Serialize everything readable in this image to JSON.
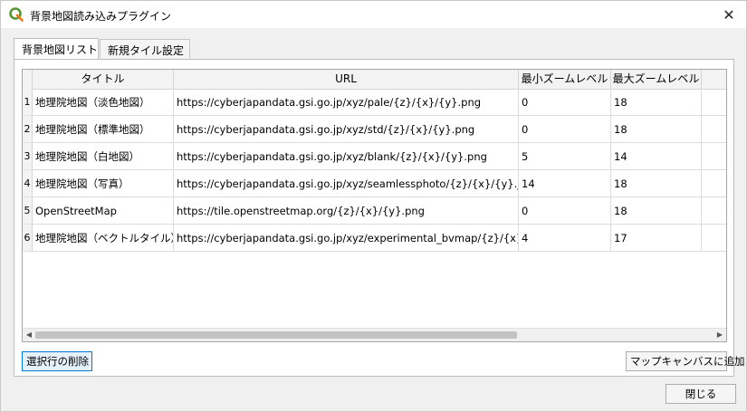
{
  "window": {
    "title": "背景地図読み込みプラグイン",
    "close_glyph": "✕"
  },
  "tabs": [
    {
      "label": "背景地図リスト",
      "active": true
    },
    {
      "label": "新規タイル設定",
      "active": false
    }
  ],
  "table": {
    "columns": [
      "タイトル",
      "URL",
      "最小ズームレベル",
      "最大ズームレベル"
    ],
    "rows": [
      {
        "num": "1",
        "title": "地理院地図（淡色地図）",
        "url": "https://cyberjapandata.gsi.go.jp/xyz/pale/{z}/{x}/{y}.png",
        "min": "0",
        "max": "18"
      },
      {
        "num": "2",
        "title": "地理院地図（標準地図）",
        "url": "https://cyberjapandata.gsi.go.jp/xyz/std/{z}/{x}/{y}.png",
        "min": "0",
        "max": "18"
      },
      {
        "num": "3",
        "title": "地理院地図（白地図）",
        "url": "https://cyberjapandata.gsi.go.jp/xyz/blank/{z}/{x}/{y}.png",
        "min": "5",
        "max": "14"
      },
      {
        "num": "4",
        "title": "地理院地図（写真）",
        "url": "https://cyberjapandata.gsi.go.jp/xyz/seamlessphoto/{z}/{x}/{y}.jpg",
        "min": "14",
        "max": "18"
      },
      {
        "num": "5",
        "title": "OpenStreetMap",
        "url": "https://tile.openstreetmap.org/{z}/{x}/{y}.png",
        "min": "0",
        "max": "18"
      },
      {
        "num": "6",
        "title": "地理院地図（ベクトルタイル）",
        "url": "https://cyberjapandata.gsi.go.jp/xyz/experimental_bvmap/{z}/{x}/{y}.pbf",
        "min": "4",
        "max": "17"
      }
    ]
  },
  "buttons": {
    "delete_selected": "選択行の削除",
    "add_to_canvas": "マップキャンバスに追加",
    "close": "閉じる"
  },
  "scrollbar": {
    "left_arrow": "◀",
    "right_arrow": "▶"
  }
}
